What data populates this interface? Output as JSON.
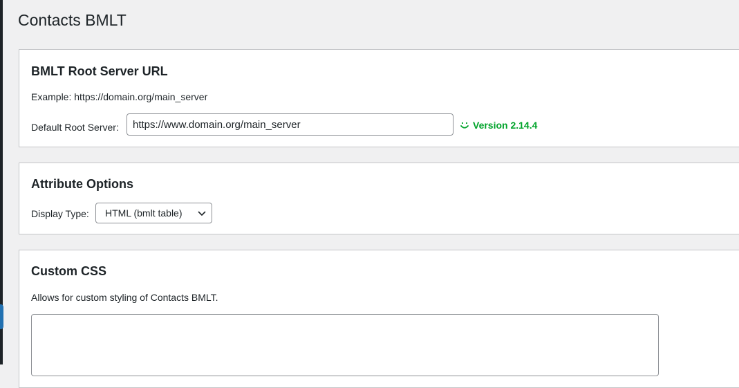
{
  "page": {
    "title": "Contacts BMLT"
  },
  "root_server": {
    "heading": "BMLT Root Server URL",
    "example": "Example: https://domain.org/main_server",
    "label": "Default Root Server:",
    "value": "https://www.domain.org/main_server",
    "version": "Version 2.14.4",
    "status_color": "#00a32a"
  },
  "attributes": {
    "heading": "Attribute Options",
    "display_type_label": "Display Type:",
    "display_type_value": "HTML (bmlt table)"
  },
  "custom_css": {
    "heading": "Custom CSS",
    "description": "Allows for custom styling of Contacts BMLT.",
    "value": ""
  },
  "colors": {
    "accent": "#2271b1",
    "admin_bar": "#1d2327",
    "background": "#f0f0f1"
  }
}
